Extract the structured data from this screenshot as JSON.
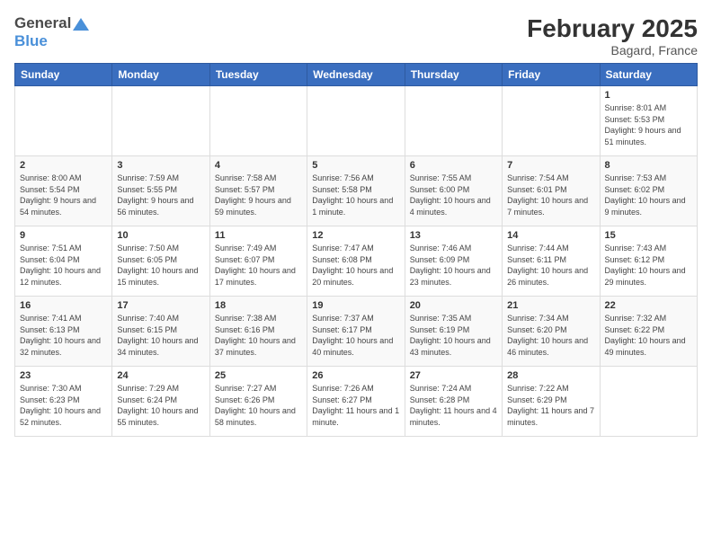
{
  "logo": {
    "line1": "General",
    "line2": "Blue"
  },
  "title": "February 2025",
  "subtitle": "Bagard, France",
  "days": [
    "Sunday",
    "Monday",
    "Tuesday",
    "Wednesday",
    "Thursday",
    "Friday",
    "Saturday"
  ],
  "weeks": [
    [
      {
        "day": "",
        "info": ""
      },
      {
        "day": "",
        "info": ""
      },
      {
        "day": "",
        "info": ""
      },
      {
        "day": "",
        "info": ""
      },
      {
        "day": "",
        "info": ""
      },
      {
        "day": "",
        "info": ""
      },
      {
        "day": "1",
        "info": "Sunrise: 8:01 AM\nSunset: 5:53 PM\nDaylight: 9 hours and 51 minutes."
      }
    ],
    [
      {
        "day": "2",
        "info": "Sunrise: 8:00 AM\nSunset: 5:54 PM\nDaylight: 9 hours and 54 minutes."
      },
      {
        "day": "3",
        "info": "Sunrise: 7:59 AM\nSunset: 5:55 PM\nDaylight: 9 hours and 56 minutes."
      },
      {
        "day": "4",
        "info": "Sunrise: 7:58 AM\nSunset: 5:57 PM\nDaylight: 9 hours and 59 minutes."
      },
      {
        "day": "5",
        "info": "Sunrise: 7:56 AM\nSunset: 5:58 PM\nDaylight: 10 hours and 1 minute."
      },
      {
        "day": "6",
        "info": "Sunrise: 7:55 AM\nSunset: 6:00 PM\nDaylight: 10 hours and 4 minutes."
      },
      {
        "day": "7",
        "info": "Sunrise: 7:54 AM\nSunset: 6:01 PM\nDaylight: 10 hours and 7 minutes."
      },
      {
        "day": "8",
        "info": "Sunrise: 7:53 AM\nSunset: 6:02 PM\nDaylight: 10 hours and 9 minutes."
      }
    ],
    [
      {
        "day": "9",
        "info": "Sunrise: 7:51 AM\nSunset: 6:04 PM\nDaylight: 10 hours and 12 minutes."
      },
      {
        "day": "10",
        "info": "Sunrise: 7:50 AM\nSunset: 6:05 PM\nDaylight: 10 hours and 15 minutes."
      },
      {
        "day": "11",
        "info": "Sunrise: 7:49 AM\nSunset: 6:07 PM\nDaylight: 10 hours and 17 minutes."
      },
      {
        "day": "12",
        "info": "Sunrise: 7:47 AM\nSunset: 6:08 PM\nDaylight: 10 hours and 20 minutes."
      },
      {
        "day": "13",
        "info": "Sunrise: 7:46 AM\nSunset: 6:09 PM\nDaylight: 10 hours and 23 minutes."
      },
      {
        "day": "14",
        "info": "Sunrise: 7:44 AM\nSunset: 6:11 PM\nDaylight: 10 hours and 26 minutes."
      },
      {
        "day": "15",
        "info": "Sunrise: 7:43 AM\nSunset: 6:12 PM\nDaylight: 10 hours and 29 minutes."
      }
    ],
    [
      {
        "day": "16",
        "info": "Sunrise: 7:41 AM\nSunset: 6:13 PM\nDaylight: 10 hours and 32 minutes."
      },
      {
        "day": "17",
        "info": "Sunrise: 7:40 AM\nSunset: 6:15 PM\nDaylight: 10 hours and 34 minutes."
      },
      {
        "day": "18",
        "info": "Sunrise: 7:38 AM\nSunset: 6:16 PM\nDaylight: 10 hours and 37 minutes."
      },
      {
        "day": "19",
        "info": "Sunrise: 7:37 AM\nSunset: 6:17 PM\nDaylight: 10 hours and 40 minutes."
      },
      {
        "day": "20",
        "info": "Sunrise: 7:35 AM\nSunset: 6:19 PM\nDaylight: 10 hours and 43 minutes."
      },
      {
        "day": "21",
        "info": "Sunrise: 7:34 AM\nSunset: 6:20 PM\nDaylight: 10 hours and 46 minutes."
      },
      {
        "day": "22",
        "info": "Sunrise: 7:32 AM\nSunset: 6:22 PM\nDaylight: 10 hours and 49 minutes."
      }
    ],
    [
      {
        "day": "23",
        "info": "Sunrise: 7:30 AM\nSunset: 6:23 PM\nDaylight: 10 hours and 52 minutes."
      },
      {
        "day": "24",
        "info": "Sunrise: 7:29 AM\nSunset: 6:24 PM\nDaylight: 10 hours and 55 minutes."
      },
      {
        "day": "25",
        "info": "Sunrise: 7:27 AM\nSunset: 6:26 PM\nDaylight: 10 hours and 58 minutes."
      },
      {
        "day": "26",
        "info": "Sunrise: 7:26 AM\nSunset: 6:27 PM\nDaylight: 11 hours and 1 minute."
      },
      {
        "day": "27",
        "info": "Sunrise: 7:24 AM\nSunset: 6:28 PM\nDaylight: 11 hours and 4 minutes."
      },
      {
        "day": "28",
        "info": "Sunrise: 7:22 AM\nSunset: 6:29 PM\nDaylight: 11 hours and 7 minutes."
      },
      {
        "day": "",
        "info": ""
      }
    ]
  ]
}
